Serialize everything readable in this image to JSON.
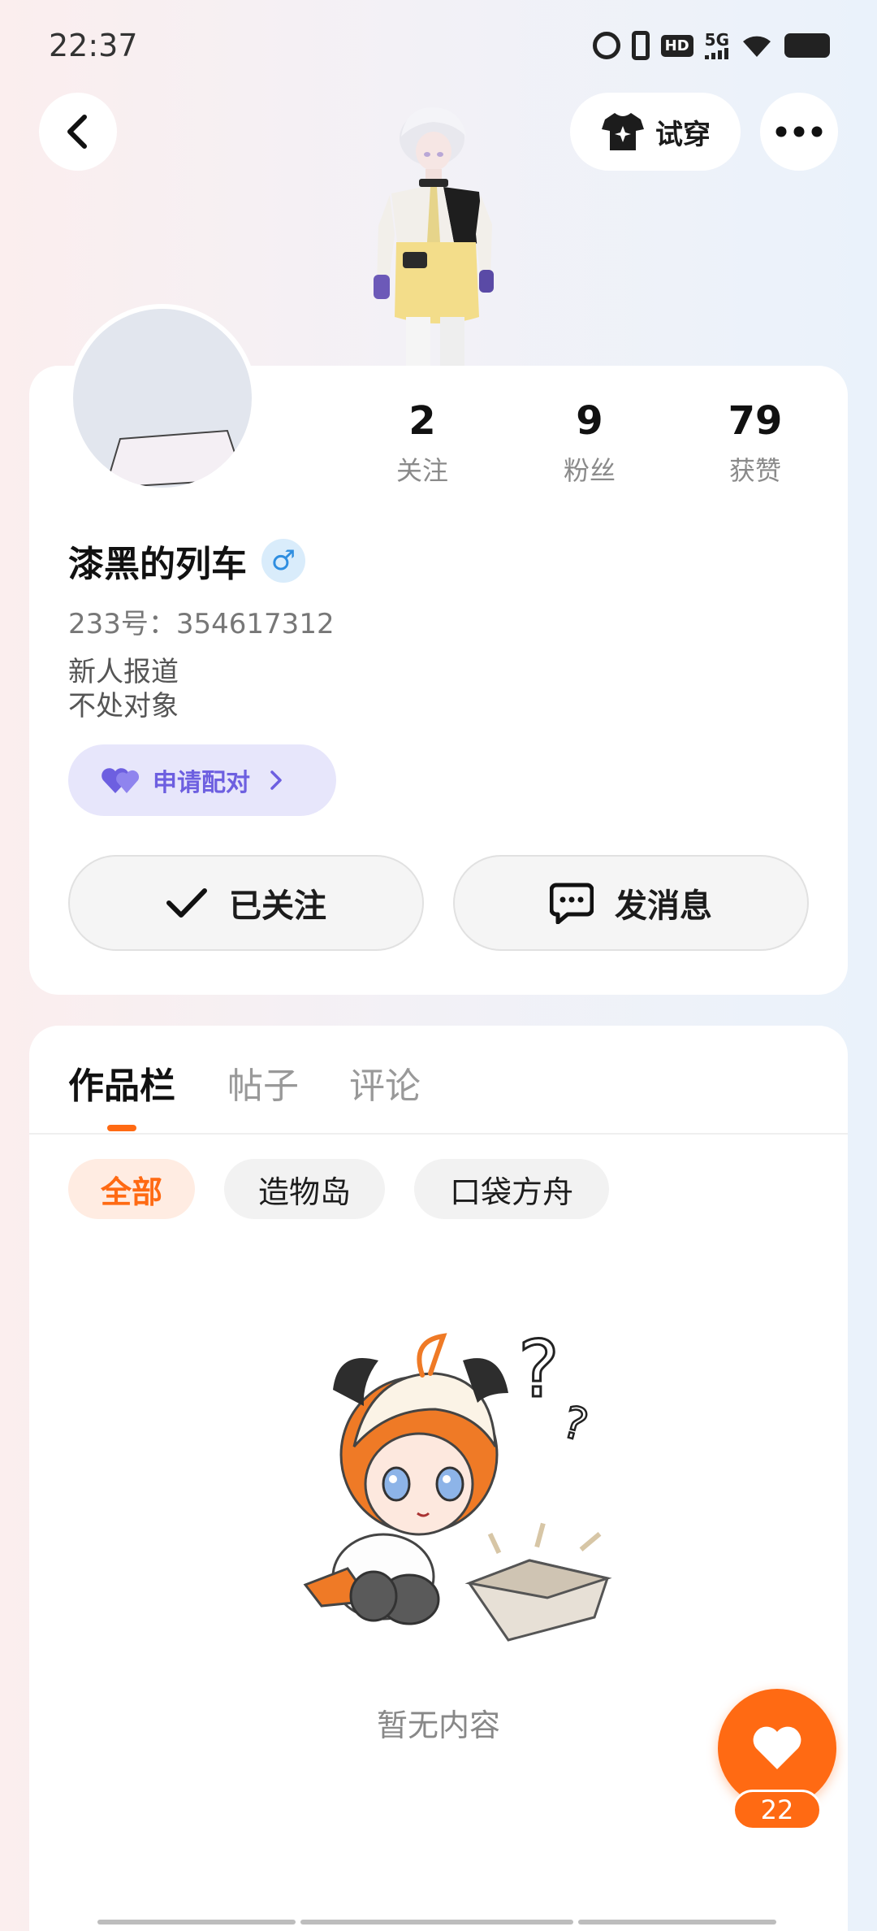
{
  "status_bar": {
    "time": "22:37",
    "icons": [
      "alarm-icon",
      "vibrate-icon",
      "hd-icon",
      "signal-5g-icon",
      "wifi-icon",
      "battery-icon"
    ],
    "hd_label": "HD",
    "network_label": "5G"
  },
  "header": {
    "back_icon": "chevron-left-icon",
    "try_on_label": "试穿",
    "try_on_icon": "tshirt-sparkle-icon",
    "more_icon": "more-dots-icon"
  },
  "profile": {
    "stats": [
      {
        "value": "2",
        "label": "关注"
      },
      {
        "value": "9",
        "label": "粉丝"
      },
      {
        "value": "79",
        "label": "获赞"
      }
    ],
    "username": "漆黑的列车",
    "gender_symbol": "♂",
    "uid": "233号：354617312",
    "bio_line1": "新人报道",
    "bio_line2": "不处对象",
    "pair_button_label": "申请配对",
    "follow_button_label": "已关注",
    "message_button_label": "发消息"
  },
  "content": {
    "tabs": [
      {
        "label": "作品栏",
        "active": true
      },
      {
        "label": "帖子",
        "active": false
      },
      {
        "label": "评论",
        "active": false
      }
    ],
    "filters": [
      {
        "label": "全部",
        "active": true
      },
      {
        "label": "造物岛",
        "active": false
      },
      {
        "label": "口袋方舟",
        "active": false
      }
    ],
    "empty_text": "暂无内容"
  },
  "like_fab": {
    "count": "22",
    "icon": "heart-icon"
  },
  "colors": {
    "accent": "#ff6a13",
    "pair_purple": "#6d5fe0",
    "gender_blue": "#2f8ee0"
  }
}
